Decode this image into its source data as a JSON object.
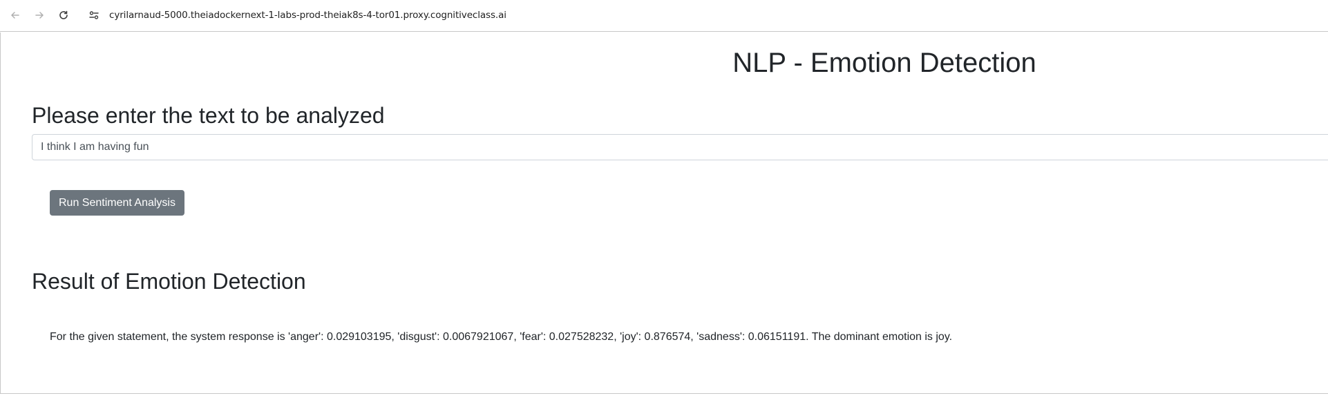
{
  "browser": {
    "url": "cyrilarnaud-5000.theiadockernext-1-labs-prod-theiak8s-4-tor01.proxy.cognitiveclass.ai",
    "icons": [
      "back-arrow-icon",
      "forward-arrow-icon",
      "reload-icon",
      "site-info-icon"
    ]
  },
  "page": {
    "title": "NLP - Emotion Detection",
    "prompt_heading": "Please enter the text to be analyzed",
    "input_value": "I think I am having fun",
    "run_button_label": "Run Sentiment Analysis",
    "result_heading": "Result of Emotion Detection",
    "result_text": "For the given statement, the system response is 'anger': 0.029103195, 'disgust': 0.0067921067, 'fear': 0.027528232, 'joy': 0.876574, 'sadness': 0.06151191. The dominant emotion is joy."
  },
  "colors": {
    "button_bg": "#6c757d",
    "text": "#212529",
    "border": "#ced4da"
  }
}
